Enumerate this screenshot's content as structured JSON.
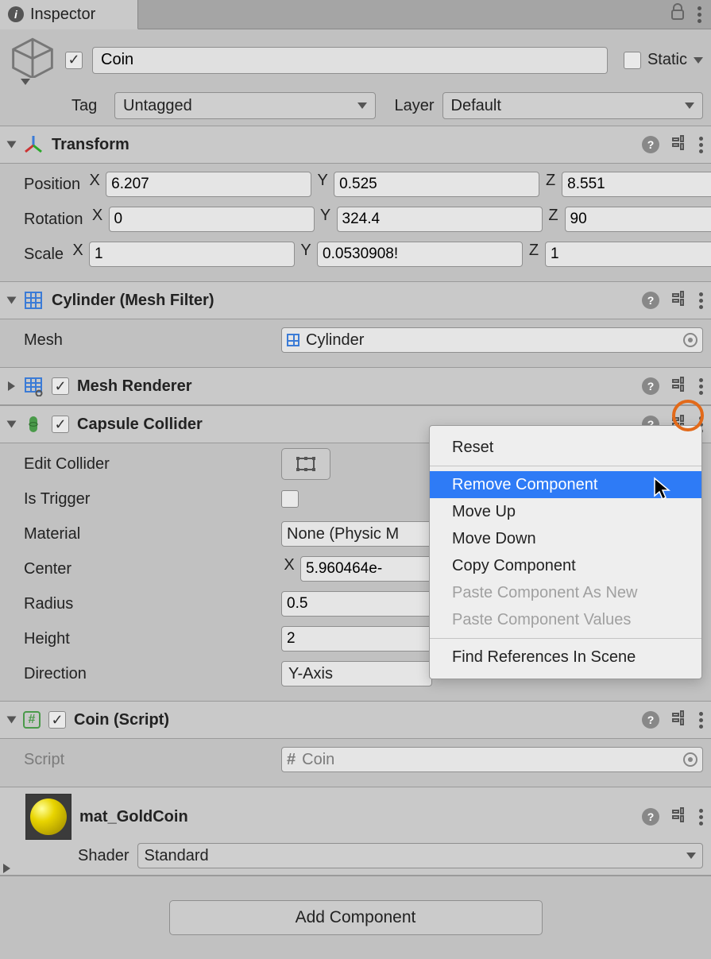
{
  "tab": {
    "title": "Inspector"
  },
  "gameobject": {
    "enabled": true,
    "name": "Coin",
    "static_label": "Static",
    "tag_label": "Tag",
    "tag_value": "Untagged",
    "layer_label": "Layer",
    "layer_value": "Default"
  },
  "transform": {
    "title": "Transform",
    "position_label": "Position",
    "position": {
      "x": "6.207",
      "y": "0.525",
      "z": "8.551"
    },
    "rotation_label": "Rotation",
    "rotation": {
      "x": "0",
      "y": "324.4",
      "z": "90"
    },
    "scale_label": "Scale",
    "scale": {
      "x": "1",
      "y": "0.0530908!",
      "z": "1"
    }
  },
  "meshfilter": {
    "title": "Cylinder (Mesh Filter)",
    "mesh_label": "Mesh",
    "mesh_value": "Cylinder"
  },
  "meshrenderer": {
    "title": "Mesh Renderer"
  },
  "capsule": {
    "title": "Capsule Collider",
    "edit_label": "Edit Collider",
    "trigger_label": "Is Trigger",
    "material_label": "Material",
    "material_value": "None (Physic M",
    "center_label": "Center",
    "center_x": "5.960464e-",
    "radius_label": "Radius",
    "radius": "0.5",
    "height_label": "Height",
    "height": "2",
    "direction_label": "Direction",
    "direction": "Y-Axis"
  },
  "script": {
    "title": "Coin (Script)",
    "script_label": "Script",
    "script_value": "Coin"
  },
  "material": {
    "name": "mat_GoldCoin",
    "shader_label": "Shader",
    "shader_value": "Standard"
  },
  "addcomponent_label": "Add Component",
  "context_menu": {
    "reset": "Reset",
    "remove": "Remove Component",
    "moveup": "Move Up",
    "movedown": "Move Down",
    "copy": "Copy Component",
    "pasteasnew": "Paste Component As New",
    "pastevalues": "Paste Component Values",
    "findrefs": "Find References In Scene"
  },
  "labels": {
    "x": "X",
    "y": "Y",
    "z": "Z"
  }
}
